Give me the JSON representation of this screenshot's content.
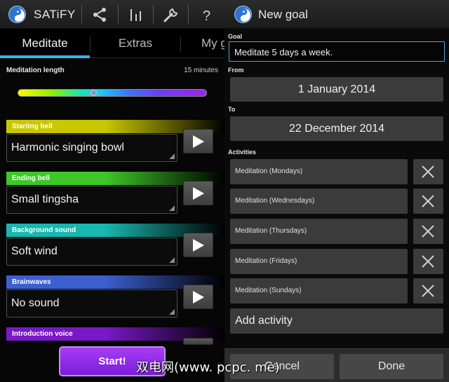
{
  "left": {
    "app_title": "SATiFY",
    "tabs": [
      {
        "label": "Meditate"
      },
      {
        "label": "Extras"
      },
      {
        "label": "My g"
      }
    ],
    "meditation_length": {
      "label": "Meditation length",
      "value": "15 minutes",
      "slider_fraction": 0.4
    },
    "sections": [
      {
        "header": "Starting bell",
        "value": "Harmonic singing bowl",
        "color": "#c9c800"
      },
      {
        "header": "Ending bell",
        "value": "Small tingsha",
        "color": "#3dc828"
      },
      {
        "header": "Background sound",
        "value": "Soft wind",
        "color": "#18b8b0"
      },
      {
        "header": "Brainwaves",
        "value": "No sound",
        "color": "#3c5fd0"
      },
      {
        "header": "Introduction voice",
        "value": "",
        "color": "#7a18c8"
      }
    ],
    "start_label": "Start!",
    "colors": {
      "accent": "#33b5e5",
      "start": "#8a2be2"
    }
  },
  "right": {
    "title": "New goal",
    "goal_label": "Goal",
    "goal_value": "Meditate 5 days a week.",
    "from_label": "From",
    "from_value": "1 January 2014",
    "to_label": "To",
    "to_value": "22 December 2014",
    "activities_label": "Activities",
    "activities": [
      "Meditation (Mondays)",
      "Meditation (Wednesdays)",
      "Meditation (Thursdays)",
      "Meditation (Fridays)",
      "Meditation (Sundays)"
    ],
    "add_activity": "Add activity",
    "cancel_label": "Cancel",
    "done_label": "Done"
  },
  "watermark": "双电网(www. pcpc. me)",
  "icons": [
    "yin-yang-logo",
    "share-icon",
    "stats-icon",
    "wrench-icon",
    "help-icon",
    "play-icon",
    "close-icon"
  ]
}
